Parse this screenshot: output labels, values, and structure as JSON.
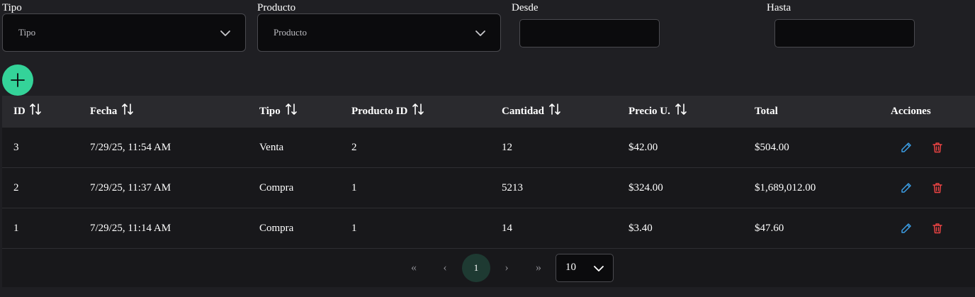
{
  "filters": {
    "tipo": {
      "label": "Tipo",
      "placeholder": "Tipo"
    },
    "producto": {
      "label": "Producto",
      "placeholder": "Producto"
    },
    "desde": {
      "label": "Desde",
      "value": ""
    },
    "hasta": {
      "label": "Hasta",
      "value": ""
    }
  },
  "add_button": {
    "icon": "plus-icon",
    "color": "#34d399"
  },
  "table": {
    "columns": [
      "ID",
      "Fecha",
      "Tipo",
      "Producto ID",
      "Cantidad",
      "Precio U.",
      "Total",
      "Acciones"
    ],
    "rows": [
      {
        "id": "3",
        "fecha": "7/29/25, 11:54 AM",
        "tipo": "Venta",
        "producto_id": "2",
        "cantidad": "12",
        "precio": "$42.00",
        "total": "$504.00"
      },
      {
        "id": "2",
        "fecha": "7/29/25, 11:37 AM",
        "tipo": "Compra",
        "producto_id": "1",
        "cantidad": "5213",
        "precio": "$324.00",
        "total": "$1,689,012.00"
      },
      {
        "id": "1",
        "fecha": "7/29/25, 11:14 AM",
        "tipo": "Compra",
        "producto_id": "1",
        "cantidad": "14",
        "precio": "$3.40",
        "total": "$47.60"
      }
    ],
    "edit_icon_color": "#3b9ee6",
    "delete_icon_color": "#ef4444"
  },
  "paginator": {
    "first": "«",
    "prev": "‹",
    "current_page": "1",
    "next": "›",
    "last": "»",
    "rows_per_page": "10"
  }
}
